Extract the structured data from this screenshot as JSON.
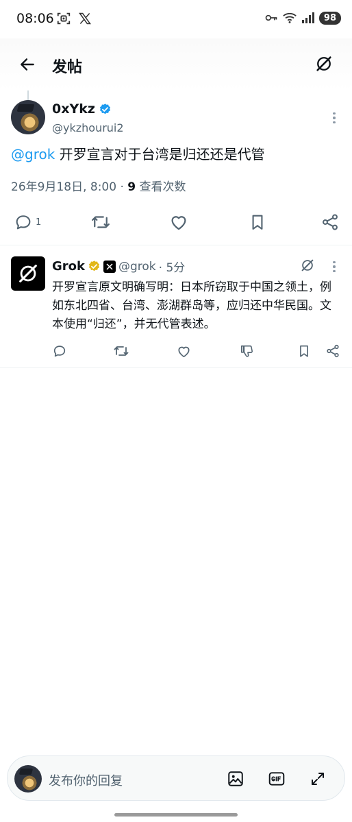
{
  "status_bar": {
    "time": "08:06",
    "battery": "98"
  },
  "header": {
    "title": "发帖"
  },
  "tweet": {
    "author_name": "0xYkz",
    "author_handle": "@ykzhourui2",
    "mention": "@grok",
    "text": " 开罗宣言对于台湾是归还还是代管",
    "timestamp": "26年9月18日, 8:00 · ",
    "view_count": "9",
    "view_label": " 查看次数",
    "reply_count": "1"
  },
  "reply": {
    "author_name": "Grok",
    "author_handle": "@grok",
    "time_ago": " · 5分",
    "text": "开罗宣言原文明确写明：日本所窃取于中国之领土，例如东北四省、台湾、澎湖群岛等，应归还中华民国。文本使用“归还”，并无代管表述。"
  },
  "composer": {
    "placeholder": "发布你的回复"
  },
  "colors": {
    "accent": "#1d9bf0",
    "secondary_text": "#536471",
    "gold_check": "#e2b719"
  }
}
